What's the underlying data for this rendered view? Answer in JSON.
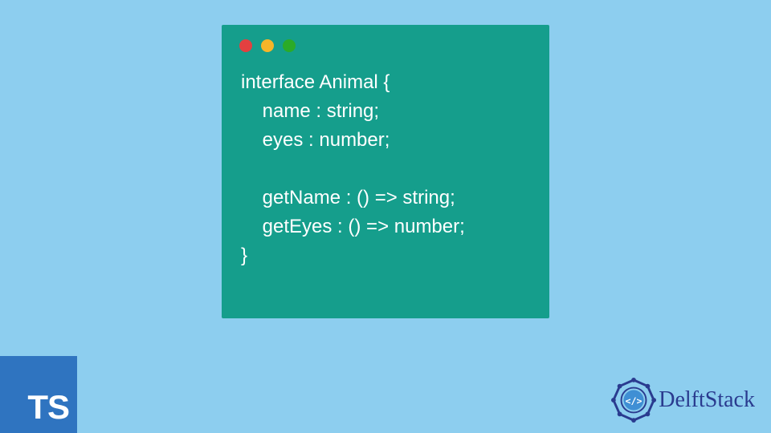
{
  "code_window": {
    "controls": [
      "red",
      "yellow",
      "green"
    ],
    "code_lines": [
      "interface Animal {",
      "    name : string;",
      "    eyes : number;",
      "",
      "    getName : () => string;",
      "    getEyes : () => number;",
      "}"
    ]
  },
  "ts_logo": {
    "text": "TS"
  },
  "delftstack": {
    "text": "DelftStack"
  }
}
